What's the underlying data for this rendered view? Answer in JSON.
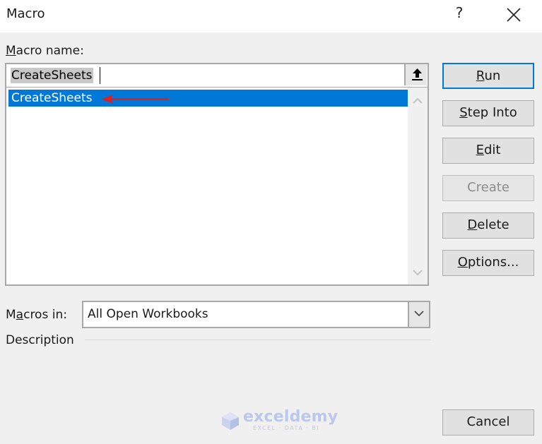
{
  "window": {
    "title": "Macro",
    "help_label": "?",
    "close_icon": "close-icon"
  },
  "macro_name": {
    "label_prefix": "M",
    "label_rest": "acro name:",
    "value": "CreateSheets",
    "collapse_icon": "collapse-up-arrow-icon"
  },
  "macro_list": {
    "items": [
      {
        "label": "CreateSheets",
        "selected": true
      }
    ],
    "annotation": "red-arrow-pointing-left"
  },
  "buttons": {
    "run": {
      "u": "R",
      "rest": "un",
      "enabled": true,
      "default": true
    },
    "step_into": {
      "u": "S",
      "rest": "tep Into",
      "enabled": true
    },
    "edit": {
      "u": "E",
      "rest": "dit",
      "enabled": true
    },
    "create": {
      "label": "Create",
      "enabled": false
    },
    "delete": {
      "u": "D",
      "rest": "elete",
      "enabled": true
    },
    "options": {
      "u": "O",
      "rest": "ptions...",
      "enabled": true
    },
    "cancel": {
      "label": "Cancel",
      "enabled": true
    }
  },
  "macros_in": {
    "label_pre": "M",
    "label_u": "a",
    "label_post": "cros in:",
    "selected": "All Open Workbooks"
  },
  "description": {
    "label": "Description"
  },
  "watermark": {
    "brand": "exceldemy",
    "tagline": "EXCEL · DATA · BI"
  },
  "colors": {
    "selection": "#0078d7",
    "default_button_border": "#0078d7",
    "annotation_arrow": "#e02020"
  }
}
